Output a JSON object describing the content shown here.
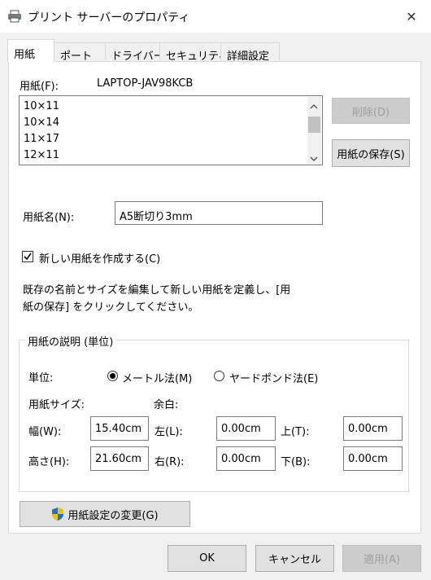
{
  "window": {
    "title": "プリント サーバーのプロパティ",
    "close_glyph": "✕"
  },
  "tabs": [
    {
      "label": "用紙",
      "active": true
    },
    {
      "label": "ポート",
      "active": false
    },
    {
      "label": "ドライバー",
      "active": false
    },
    {
      "label": "セキュリティ",
      "active": false
    },
    {
      "label": "詳細設定",
      "active": false
    }
  ],
  "forms": {
    "label": "用紙(F):",
    "server_name": "LAPTOP-JAV98KCB",
    "items": [
      "10×11",
      "10×14",
      "11×17",
      "12×11"
    ],
    "delete_button": "削除(D)",
    "save_button": "用紙の保存(S)"
  },
  "form_name": {
    "label": "用紙名(N):",
    "value": "A5断切り3mm"
  },
  "create_new": {
    "label": "新しい用紙を作成する(C)",
    "checked": true
  },
  "description_text": {
    "line1": "既存の名前とサイズを編集して新しい用紙を定義し、[用",
    "line2": "紙の保存] をクリックしてください。"
  },
  "group": {
    "title": "用紙の説明 (単位)",
    "unit_label": "単位:",
    "metric_label": "メートル法(M)",
    "english_label": "ヤードポンド法(E)",
    "selected_unit": "metric",
    "paper_size_label": "用紙サイズ:",
    "margins_label": "余白:",
    "width_label": "幅(W):",
    "width_value": "15.40cm",
    "height_label": "高さ(H):",
    "height_value": "21.60cm",
    "left_label": "左(L):",
    "left_value": "0.00cm",
    "right_label": "右(R):",
    "right_value": "0.00cm",
    "top_label": "上(T):",
    "top_value": "0.00cm",
    "bottom_label": "下(B):",
    "bottom_value": "0.00cm"
  },
  "change_settings_button": "用紙設定の変更(G)",
  "footer": {
    "ok": "OK",
    "cancel": "キャンセル",
    "apply": "適用(A)"
  },
  "colors": {
    "shield_blue": "#1f6fd0",
    "shield_yellow": "#f2c300"
  }
}
